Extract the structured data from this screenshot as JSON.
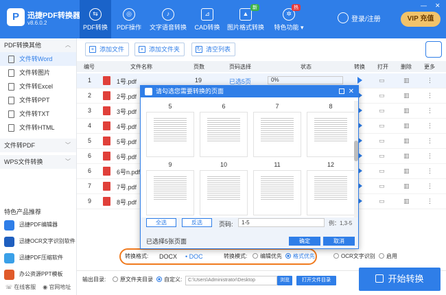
{
  "app": {
    "name": "迅捷PDF转换器",
    "version": "v8.6.0.2",
    "logo_text": "P"
  },
  "nav": [
    {
      "label": "PDF转换"
    },
    {
      "label": "PDF操作"
    },
    {
      "label": "文字语音转换"
    },
    {
      "label": "CAD转换"
    },
    {
      "label": "图片格式转换",
      "badge": "新"
    },
    {
      "label": "特色功能 ▾",
      "badge": "热"
    }
  ],
  "user": {
    "login_label": "登录/注册",
    "vip_label": "VIP 充值"
  },
  "window_controls": {
    "minimize": "—",
    "close": "✕"
  },
  "sidebar": {
    "groups": [
      {
        "title": "PDF转换其他",
        "chevron": "︿"
      },
      {
        "title": "文件转PDF",
        "chevron": "﹀"
      },
      {
        "title": "WPS文件转换",
        "chevron": "﹀"
      }
    ],
    "items": [
      {
        "label": "文件转Word"
      },
      {
        "label": "文件转图片"
      },
      {
        "label": "文件转Excel"
      },
      {
        "label": "文件转PPT"
      },
      {
        "label": "文件转TXT"
      },
      {
        "label": "文件转HTML"
      }
    ],
    "special_title": "特色产品推荐",
    "products": [
      {
        "label": "迅捷PDF编辑器"
      },
      {
        "label": "迅捷OCR文字识别软件"
      },
      {
        "label": "迅捷PDF压缩软件"
      },
      {
        "label": "办公资源PPT模板"
      }
    ],
    "bottom": {
      "online_service": "在线客服",
      "website": "官网地址"
    }
  },
  "toolbar": {
    "add_file": "添加文件",
    "add_folder": "添加文件夹",
    "clear_list": "清空列表"
  },
  "table": {
    "headers": {
      "num": "编号",
      "name": "文件名称",
      "pages": "页数",
      "page_select": "页码选择",
      "status": "状态",
      "convert": "转换",
      "open": "打开",
      "delete": "删除",
      "more": "更多"
    },
    "rows": [
      {
        "num": "1",
        "name": "1号.pdf",
        "pages": "19",
        "page_select": "已选5页",
        "status": "0%"
      },
      {
        "num": "2",
        "name": "2号.pdf"
      },
      {
        "num": "3",
        "name": "3号.pdf"
      },
      {
        "num": "4",
        "name": "4号.pdf"
      },
      {
        "num": "5",
        "name": "5号.pdf"
      },
      {
        "num": "6",
        "name": "6号.pdf"
      },
      {
        "num": "6",
        "name": "6号n.pdf"
      },
      {
        "num": "7",
        "name": "7号.pdf"
      },
      {
        "num": "9",
        "name": "8号.pdf"
      }
    ]
  },
  "dialog": {
    "title": "请勾选您需要转换的页面",
    "page_numbers_row1": [
      "5",
      "6",
      "7",
      "8"
    ],
    "page_numbers_row2": [
      "9",
      "10",
      "11",
      "12"
    ],
    "select_all": "全选",
    "invert_select": "反选",
    "page_code_label": "页码:",
    "page_code_value": "1-5",
    "example": "例：1,3-5",
    "selected_info": "已选择5张页面",
    "confirm": "确定",
    "cancel": "取消"
  },
  "options": {
    "format_label": "转换格式:",
    "format_docx": "DOCX",
    "format_doc": "DOC",
    "mode_label": "转换模式:",
    "mode_edit": "编辑优先",
    "mode_format": "格式优先",
    "ocr_label": "OCR文字识别",
    "enable_label": "启用"
  },
  "output": {
    "label": "输出目录:",
    "original_dir": "原文件夹目录",
    "custom": "自定义:",
    "path": "C:\\Users\\Administrator\\Desktop",
    "browse": "浏览",
    "open_folder": "打开文件目录"
  },
  "start_label": "开始转换",
  "colors": {
    "primary": "#2f7ee8",
    "highlight": "#f07a1e",
    "pdf_red": "#e0403a"
  }
}
